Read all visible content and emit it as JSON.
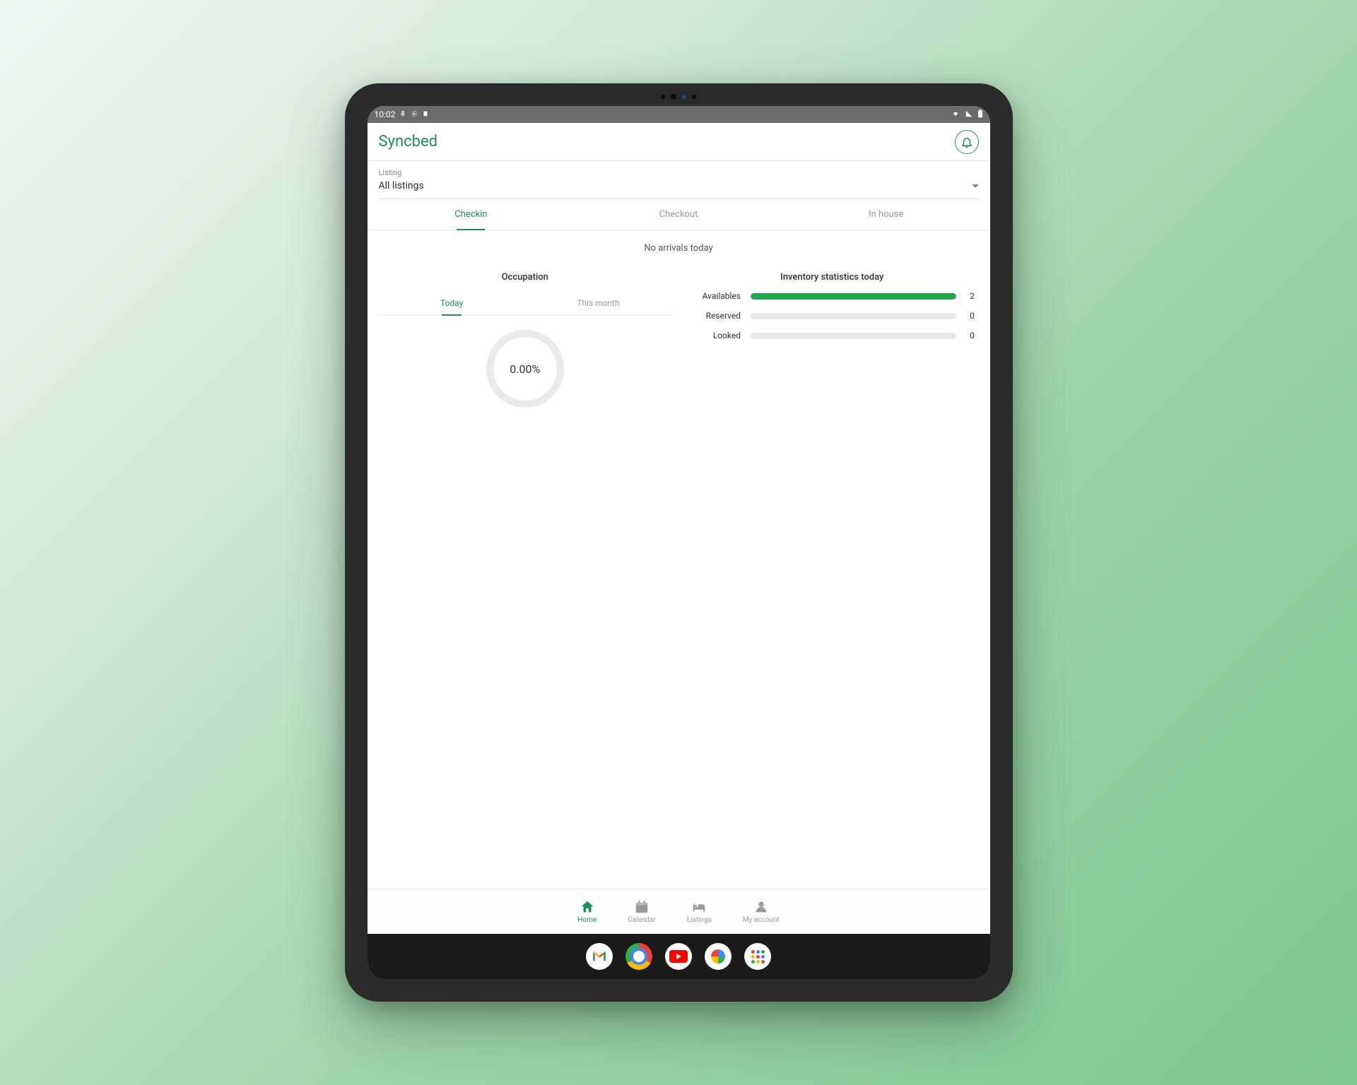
{
  "status": {
    "time": "10:02"
  },
  "header": {
    "title": "Syncbed"
  },
  "listing": {
    "label": "Listing",
    "value": "All listings"
  },
  "tabs": {
    "checkin": "Checkin",
    "checkout": "Checkout",
    "inhouse": "In house"
  },
  "message": {
    "no_arrivals": "No arrivals today"
  },
  "occupation": {
    "title": "Occupation",
    "tab_today": "Today",
    "tab_month": "This month",
    "percent": "0.00%"
  },
  "inventory": {
    "title": "Inventory statistics today",
    "rows": {
      "availables": {
        "label": "Availables",
        "value": "2"
      },
      "reserved": {
        "label": "Reserved",
        "value": "0"
      },
      "looked": {
        "label": "Looked",
        "value": "0"
      }
    }
  },
  "nav": {
    "home": "Home",
    "calendar": "Calendar",
    "listings": "Listings",
    "account": "My account"
  },
  "chart_data": {
    "type": "bar",
    "title": "Inventory statistics today",
    "categories": [
      "Availables",
      "Reserved",
      "Looked"
    ],
    "values": [
      2,
      0,
      0
    ],
    "xlabel": "",
    "ylabel": "",
    "ylim": [
      0,
      2
    ]
  }
}
